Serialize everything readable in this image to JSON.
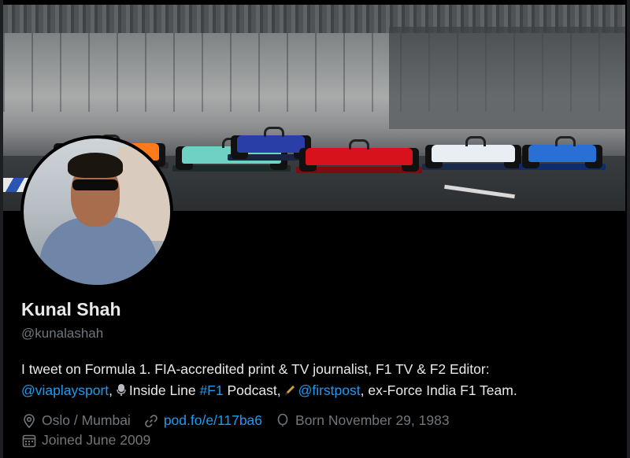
{
  "profile": {
    "name": "Kunal Shah",
    "handle": "@kunalashah",
    "bio": {
      "line1": "I tweet on Formula 1. FIA-accredited print & TV journalist, F1 TV & F2 Editor:",
      "mention1": "@viaplaysport",
      "comma1": ",",
      "part2": "Inside Line",
      "hashtag": "#F1",
      "part3": "Podcast,",
      "mention2": "@firstpost",
      "part4": ", ex-Force India F1 Team."
    },
    "meta": {
      "location": "Oslo / Mumbai",
      "website": "pod.fo/e/117ba6",
      "birthday": "Born November 29, 1983",
      "joined": "Joined June 2009"
    }
  },
  "icons": [
    "location-icon",
    "link-icon",
    "balloon-icon",
    "calendar-icon",
    "microphone-icon",
    "pen-icon"
  ],
  "colors": {
    "background": "#000000",
    "text": "#e7e9ea",
    "muted": "#71767b",
    "accent": "#1d9bf0"
  }
}
